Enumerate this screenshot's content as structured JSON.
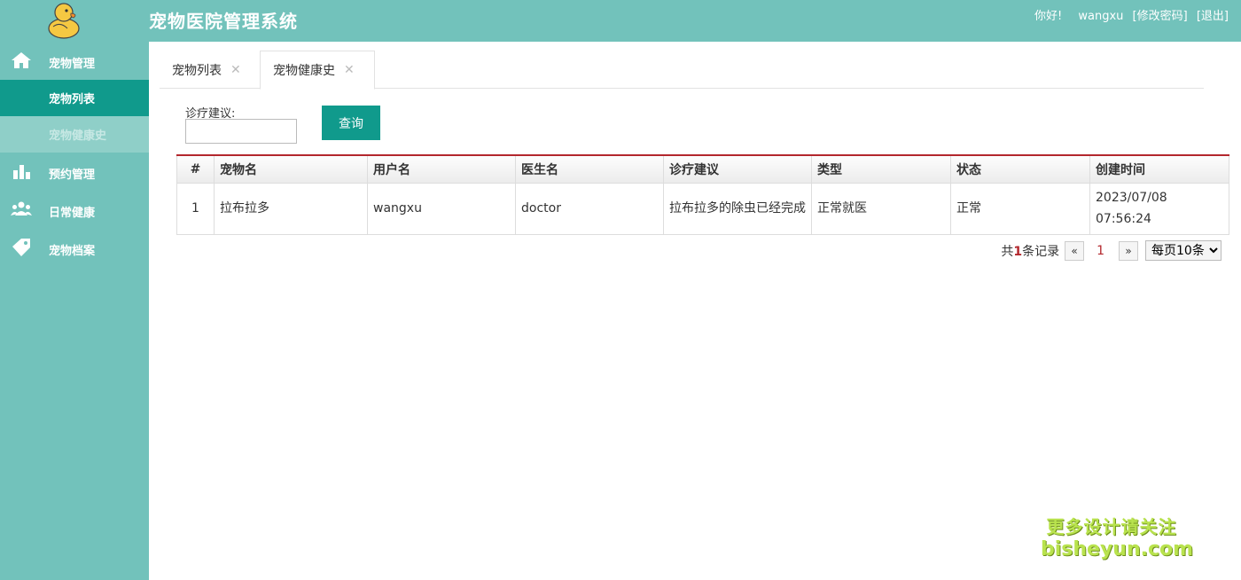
{
  "header": {
    "title": "宠物医院管理系统",
    "greeting": "你好!",
    "username": "wangxu",
    "change_password": "[修改密码]",
    "logout": "[退出]"
  },
  "sidebar": {
    "groups": [
      {
        "label": "宠物管理",
        "icon": "home-icon"
      },
      {
        "label": "预约管理",
        "icon": "bar-chart-icon"
      },
      {
        "label": "日常健康",
        "icon": "users-icon"
      },
      {
        "label": "宠物档案",
        "icon": "tag-icon"
      }
    ],
    "sub_items": [
      {
        "label": "宠物列表",
        "state": "active"
      },
      {
        "label": "宠物健康史",
        "state": "disabled"
      }
    ]
  },
  "tabs": [
    {
      "label": "宠物列表",
      "close": "✕"
    },
    {
      "label": "宠物健康史",
      "close": "✕"
    }
  ],
  "search": {
    "label": "诊疗建议:",
    "value": "",
    "button": "查询"
  },
  "table": {
    "columns": [
      "#",
      "宠物名",
      "用户名",
      "医生名",
      "诊疗建议",
      "类型",
      "状态",
      "创建时间"
    ],
    "rows": [
      [
        "1",
        "拉布拉多",
        "wangxu",
        "doctor",
        "拉布拉多的除虫已经完成",
        "正常就医",
        "正常",
        "2023/07/08 07:56:24"
      ]
    ]
  },
  "pagination": {
    "prefix": "共",
    "count": "1",
    "suffix": "条记录",
    "prev": "«",
    "current": "1",
    "next": "»",
    "page_size": "每页10条"
  },
  "watermark": {
    "line1": "更多设计请关注",
    "line2": "bisheyun.com"
  },
  "colors": {
    "header_bg": "#72c2bb",
    "accent": "#109a8c",
    "table_top_border": "#b3272d"
  }
}
